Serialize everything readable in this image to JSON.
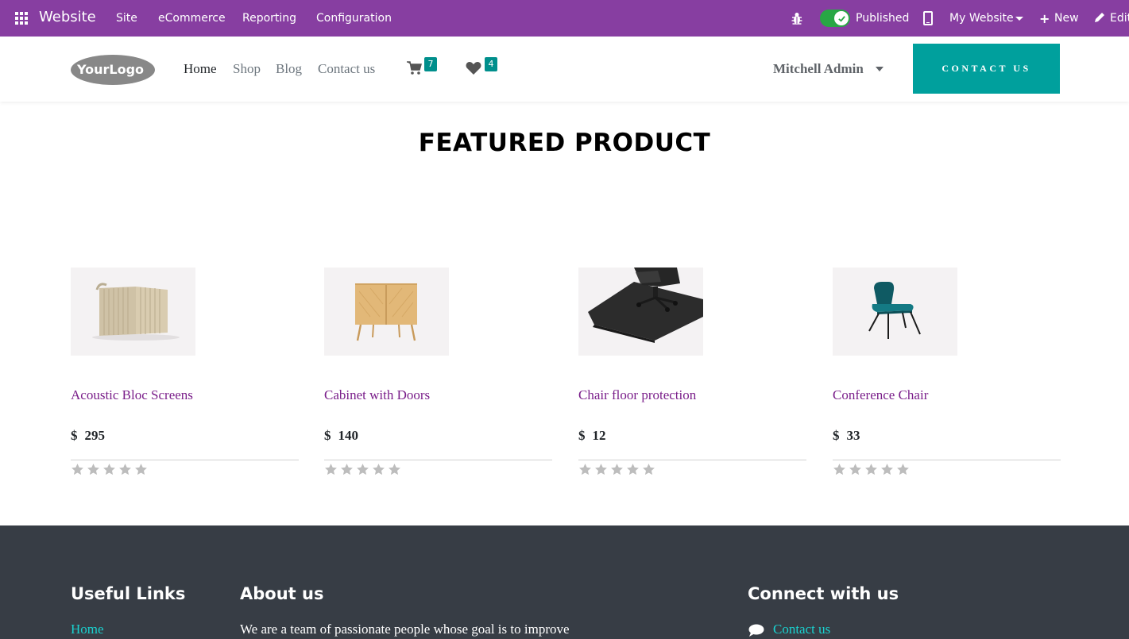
{
  "admin_bar": {
    "app_title": "Website",
    "menus": [
      "Site",
      "eCommerce",
      "Reporting",
      "Configuration"
    ],
    "published_label": "Published",
    "published": true,
    "website_selector": "My Website",
    "new_label": "New",
    "edit_label": "Edit",
    "icons": [
      "apps-icon",
      "bug-icon",
      "mobile-icon",
      "plus-icon",
      "pencil-icon"
    ],
    "color": "#873ea1"
  },
  "header": {
    "logo_text": "YourLogo",
    "nav": [
      "Home",
      "Shop",
      "Blog",
      "Contact us"
    ],
    "active_nav": "Home",
    "cart_count": "7",
    "wishlist_count": "4",
    "user_name": "Mitchell Admin",
    "cta_label": "CONTACT US",
    "accent_color": "#00a09d"
  },
  "section": {
    "title": "FEATURED PRODUCT"
  },
  "products": [
    {
      "name": "Acoustic Bloc Screens",
      "currency": "$",
      "price": "295",
      "rating": 0,
      "image": "acoustic-screen"
    },
    {
      "name": "Cabinet with Doors",
      "currency": "$",
      "price": "140",
      "rating": 0,
      "image": "cabinet"
    },
    {
      "name": "Chair floor protection",
      "currency": "$",
      "price": "12",
      "rating": 0,
      "image": "chair-mat"
    },
    {
      "name": "Conference Chair",
      "currency": "$",
      "price": "33",
      "rating": 0,
      "image": "conference-chair"
    }
  ],
  "footer": {
    "useful_links_heading": "Useful Links",
    "useful_links": [
      "Home"
    ],
    "about_heading": "About us",
    "about_text": "We are a team of passionate people whose goal is to improve",
    "connect_heading": "Connect with us",
    "connect_link": "Contact us",
    "background": "#373d45",
    "link_color": "#1ad1cf"
  }
}
